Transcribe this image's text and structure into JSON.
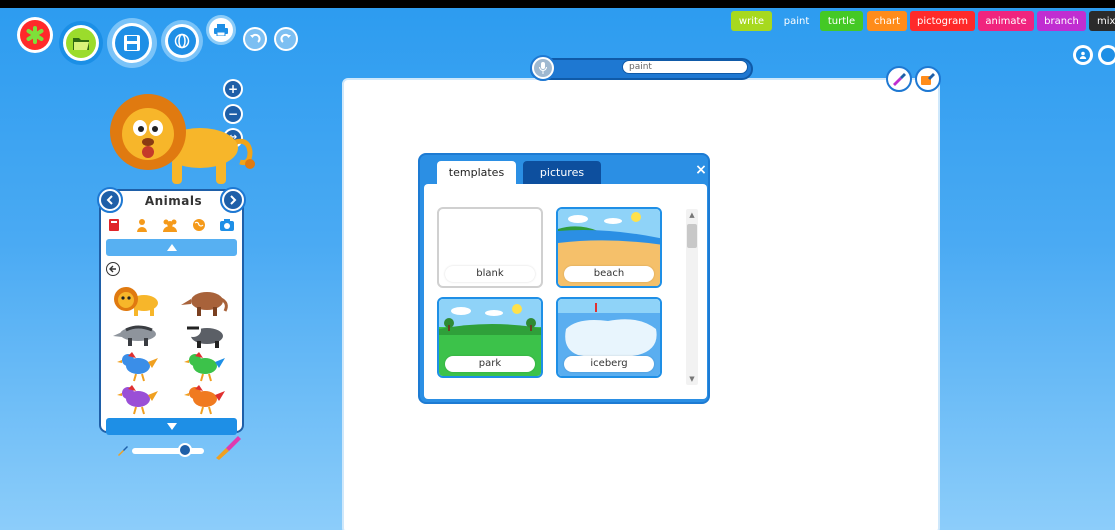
{
  "toolbar": {
    "new_icon": "asterisk-icon",
    "open_icon": "folder-icon",
    "save_icon": "floppy-disk-icon",
    "share_icon": "globe-icon",
    "print_icon": "printer-icon",
    "undo_icon": "undo-icon",
    "redo_icon": "redo-icon"
  },
  "mode_tabs": [
    {
      "label": "write",
      "color": "#a7d91e"
    },
    {
      "label": "paint",
      "color": "#3aa0f0"
    },
    {
      "label": "turtle",
      "color": "#44c925"
    },
    {
      "label": "chart",
      "color": "#ff8c1a"
    },
    {
      "label": "pictogram",
      "color": "#ff2a2a"
    },
    {
      "label": "animate",
      "color": "#f0247e"
    },
    {
      "label": "branch",
      "color": "#c02ed1"
    },
    {
      "label": "mix",
      "color": "#2b2b2b"
    }
  ],
  "title": {
    "value": "paint",
    "mic_icon": "microphone-icon"
  },
  "zoom": {
    "in_label": "+",
    "out_label": "−",
    "fit_label": "↔"
  },
  "sticker_panel": {
    "category": "Animals",
    "category_icons": [
      "book-icon",
      "person-icon",
      "group-icon",
      "globe-icon",
      "camera-icon"
    ],
    "items": [
      "lion",
      "aardvark",
      "anteater",
      "badger",
      "blue-bird",
      "green-bird",
      "purple-bird",
      "orange-bird"
    ]
  },
  "dialog": {
    "tabs": [
      "templates",
      "pictures"
    ],
    "active_tab": "templates",
    "close_label": "×",
    "templates": [
      {
        "label": "blank"
      },
      {
        "label": "beach"
      },
      {
        "label": "park"
      },
      {
        "label": "iceberg"
      }
    ]
  },
  "colors": {
    "background_top": "#2d9cf0",
    "background_bottom": "#8ccdfa",
    "accent": "#1e5fa8",
    "dialog": "#2b8fe4"
  }
}
